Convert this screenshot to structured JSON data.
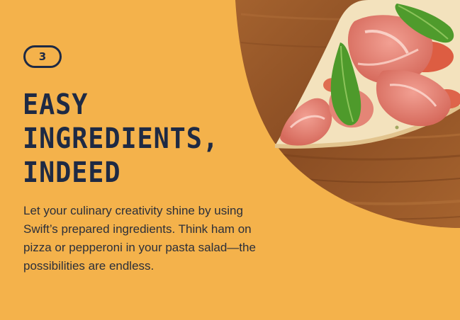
{
  "step": {
    "number": "3"
  },
  "headline": {
    "line1": "EASY",
    "line2": "INGREDIENTS,",
    "line3": "INDEED"
  },
  "body": {
    "text": "Let your culinary creativity shine by using Swift’s prepared ingredients. Think ham on pizza or pepperoni in your pasta salad—the possibilities are endless."
  },
  "colors": {
    "background": "#f4b24b",
    "navy_text": "#1e2a44",
    "body_text": "#2b2f3a",
    "wood_board": "#9a5a2c"
  },
  "image": {
    "subject": "pizza-slice-with-prosciutto-and-arugula-on-wooden-board"
  }
}
